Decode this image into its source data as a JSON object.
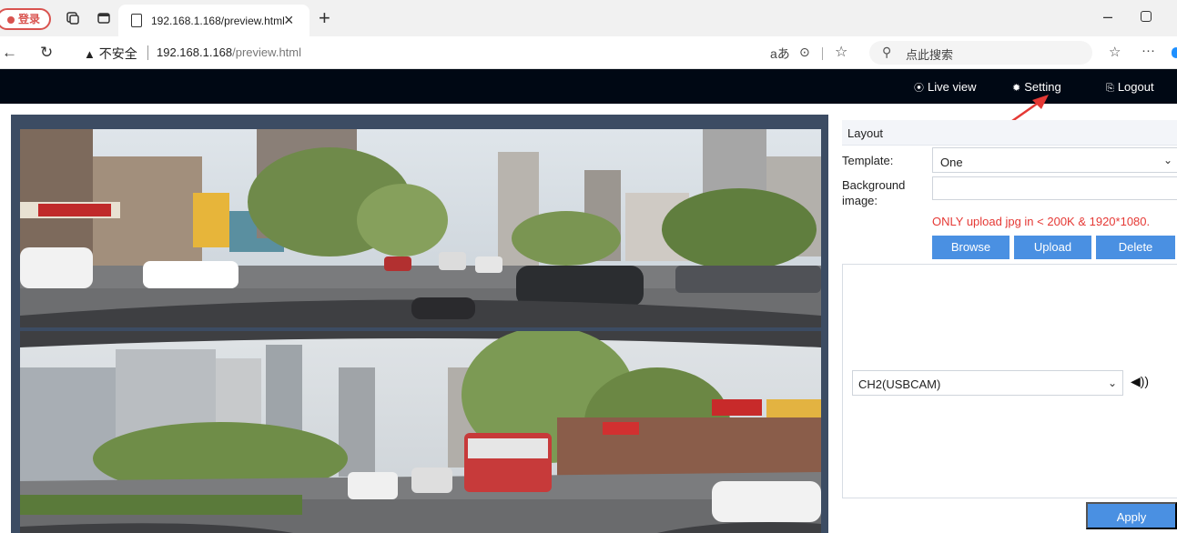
{
  "browser": {
    "login_badge": "登录",
    "tab_title": "192.168.1.168/preview.html",
    "tab_close": "×",
    "new_tab": "+",
    "window_min": "–",
    "security_warning": "不安全",
    "url_host": "192.168.1.168",
    "url_path": "/preview.html",
    "read_aloud": "aあ",
    "search_placeholder": "点此搜索",
    "more": "···"
  },
  "header": {
    "live_view": "Live view",
    "setting": "Setting",
    "logout": "Logout"
  },
  "panel": {
    "section_title": "Layout",
    "template_label": "Template:",
    "template_value": "One",
    "background_label_1": "Background",
    "background_label_2": "image:",
    "upload_note": "ONLY upload jpg in < 200K & 1920*1080.",
    "browse": "Browse",
    "upload": "Upload",
    "delete": "Delete",
    "channel_value": "CH2(USBCAM)",
    "apply": "Apply"
  },
  "colors": {
    "accent": "#4a90e2",
    "header_bg": "#000814",
    "warning": "#e53935",
    "annotation_arrow": "#e53935"
  },
  "icons": {
    "tab_page": "page-icon",
    "live_view": "play-circle-icon",
    "setting": "gear-icon",
    "logout": "logout-icon",
    "speaker": "speaker-icon"
  }
}
